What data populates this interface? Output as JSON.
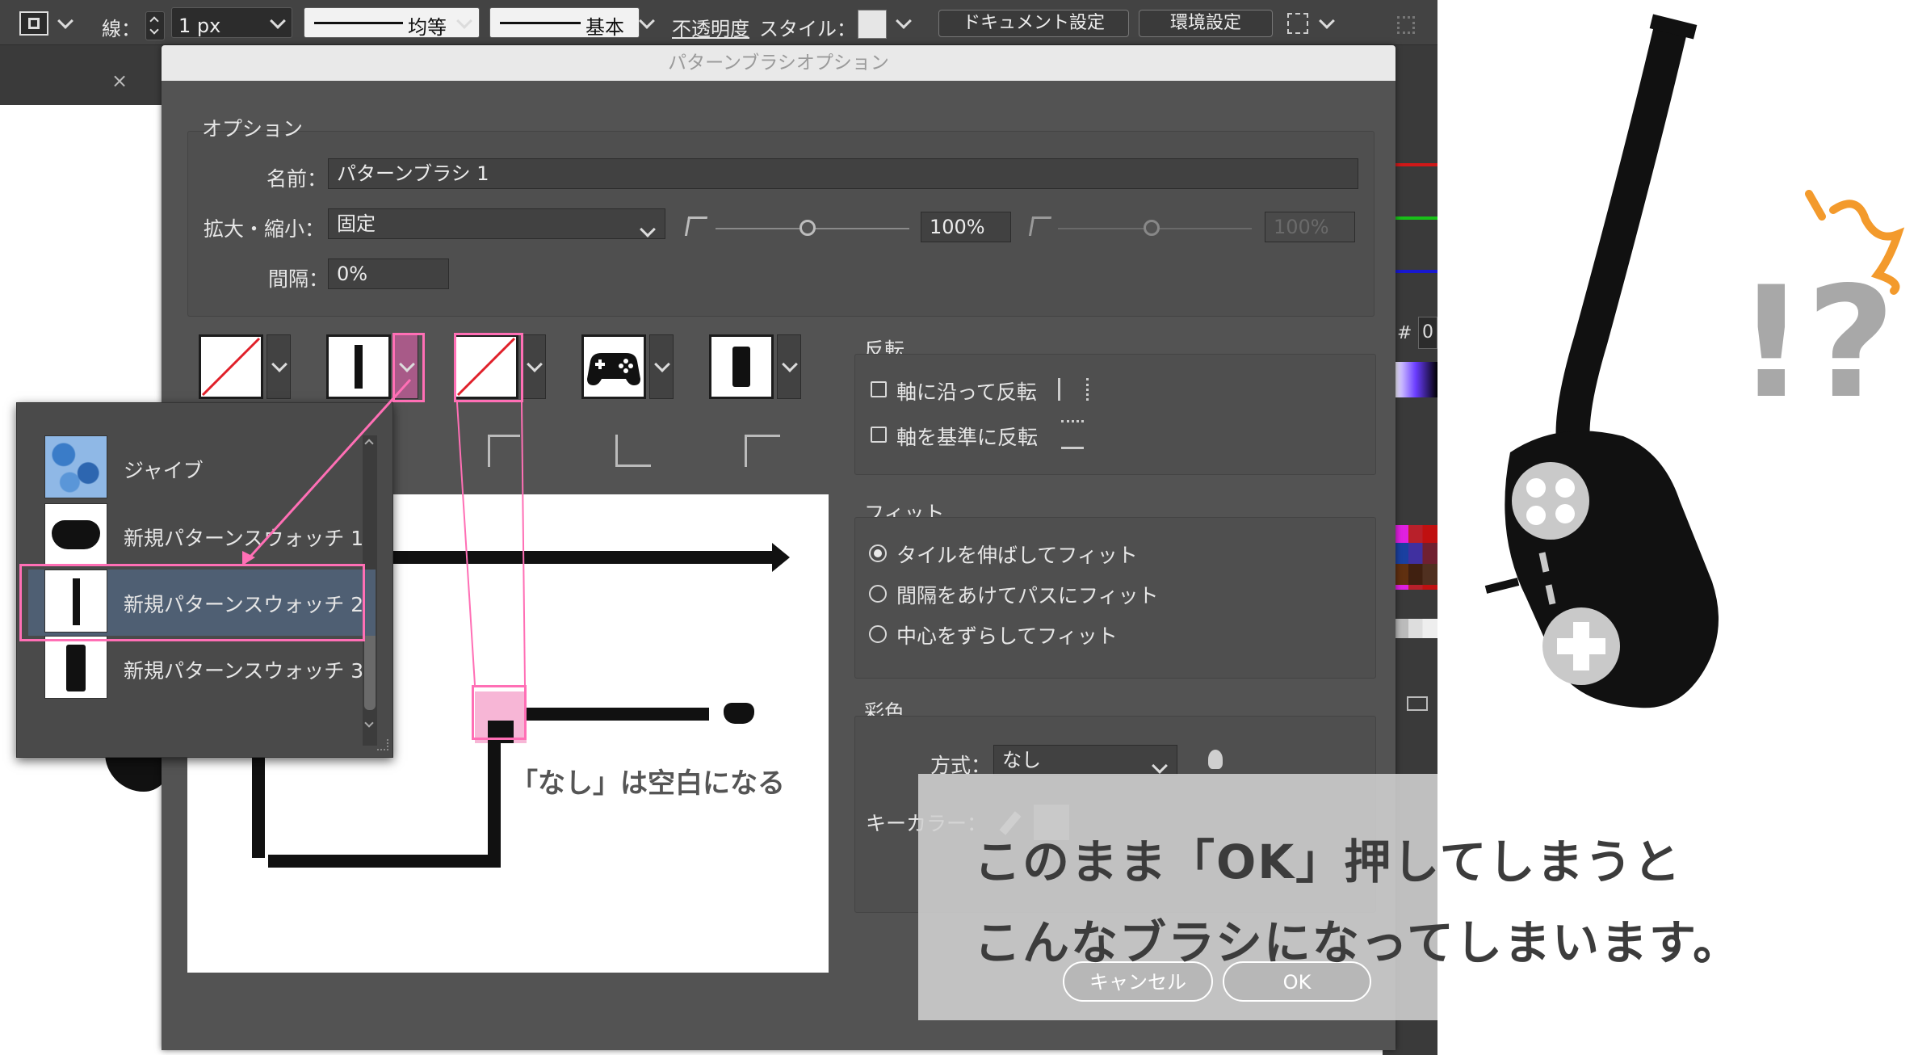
{
  "control_bar": {
    "stroke_label": "線：",
    "stroke_width": "1 px",
    "profile_label": "均等",
    "brush_label": "基本",
    "opacity_label": "不透明度",
    "style_label": "スタイル：",
    "doc_settings_button": "ドキュメント設定",
    "prefs_button": "環境設定"
  },
  "dialog": {
    "title": "パターンブラシオプション",
    "options_group": {
      "title": "オプション",
      "name_label": "名前：",
      "name_value": "パターンブラシ 1",
      "scale_label": "拡大・縮小：",
      "scale_mode": "固定",
      "scale_value": "100%",
      "scale_value_max": "100%",
      "spacing_label": "間隔：",
      "spacing_value": "0%"
    },
    "flip_group": {
      "title": "反転",
      "along_label": "軸に沿って反転",
      "across_label": "軸を基準に反転"
    },
    "fit_group": {
      "title": "フィット",
      "opt1": "タイルを伸ばしてフィット",
      "opt2": "間隔をあけてパスにフィット",
      "opt3": "中心をずらしてフィット",
      "selected": "タイルを伸ばしてフィット"
    },
    "color_group": {
      "title": "彩色",
      "method_label": "方式：",
      "method_value": "なし",
      "key_color_label": "キーカラー："
    },
    "cancel_button": "キャンセル",
    "ok_button": "OK"
  },
  "dropdown": {
    "items": [
      {
        "label": "ジャイブ"
      },
      {
        "label": "新規パターンスウォッチ 1"
      },
      {
        "label": "新規パターンスウォッチ 2"
      },
      {
        "label": "新規パターンスウォッチ 3"
      }
    ],
    "selected": "新規パターンスウォッチ 2"
  },
  "panel": {
    "hash_label": "#",
    "hex_partial": "0"
  },
  "annotations": {
    "preview_note": "「なし」は空白になる",
    "bottom_line1": "このまま「OK」押してしまうと",
    "bottom_line2": "こんなブラシになってしまいます。",
    "exclaim": "!?"
  },
  "colors": {
    "dialog_bg": "#535353",
    "highlight_pink": "#ff6fb5",
    "selected_item": "#4f5f73",
    "squiggle_orange": "#f39a2c"
  }
}
